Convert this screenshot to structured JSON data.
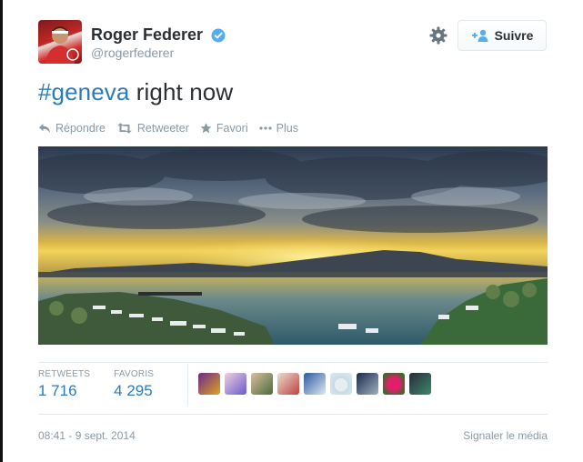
{
  "author": {
    "fullname": "Roger Federer",
    "screen_name": "@rogerfederer",
    "verified_icon": "verified-badge-icon"
  },
  "header": {
    "settings_icon": "gear-icon",
    "follow_label": "Suivre"
  },
  "tweet": {
    "hashtag": "#geneva",
    "text": " right now"
  },
  "actions": {
    "reply": "Répondre",
    "retweet": "Retweeter",
    "favorite": "Favori",
    "more": "Plus"
  },
  "stats": {
    "retweets_label": "RETWEETS",
    "retweets_value": "1 716",
    "favorites_label": "FAVORIS",
    "favorites_value": "4 295"
  },
  "footer": {
    "timestamp": "08:41 - 9 sept. 2014",
    "report_media": "Signaler le média"
  },
  "colors": {
    "link": "#2b7bb9",
    "muted": "#8899a6",
    "text": "#292f33",
    "verified": "#55acee"
  }
}
